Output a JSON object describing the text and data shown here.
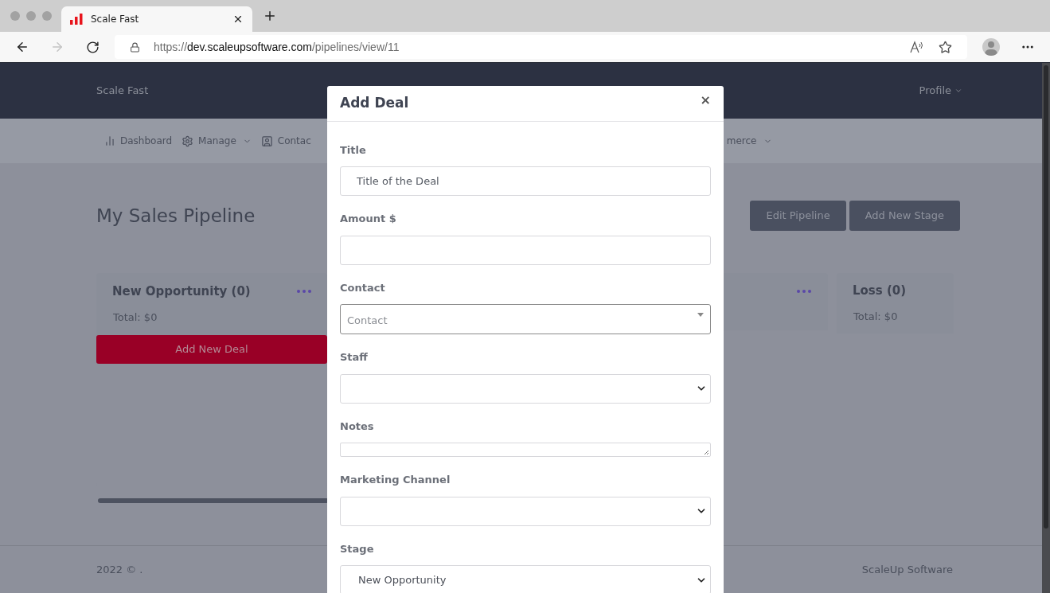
{
  "browser": {
    "tab_title": "Scale Fast",
    "url_scheme": "https://",
    "url_host": "dev.scaleupsoftware.com",
    "url_path": "/pipelines/view/11"
  },
  "navbar": {
    "brand": "Scale Fast",
    "profile": "Profile"
  },
  "nav_items": [
    {
      "label": "Dashboard",
      "caret": false
    },
    {
      "label": "Manage",
      "caret": true
    },
    {
      "label": "Contac",
      "caret": false
    },
    {
      "label": "merce",
      "caret": true
    }
  ],
  "page": {
    "title": "My Sales Pipeline",
    "buttons": [
      "Edit Pipeline",
      "Add New Stage"
    ]
  },
  "stages": [
    {
      "kind": "full",
      "title": "New Opportunity (0)",
      "total": "Total: $0",
      "add_button": "Add New Deal"
    },
    {
      "kind": "hidden"
    },
    {
      "kind": "plain",
      "title": "Loss (0)",
      "total": "Total: $0"
    }
  ],
  "footer": {
    "left": "2022 © .",
    "right": "ScaleUp Software"
  },
  "modal": {
    "title": "Add Deal",
    "close": "×",
    "fields": [
      {
        "label": "Title",
        "kind": "text",
        "placeholder": "Title of the Deal"
      },
      {
        "label": "Amount $",
        "kind": "text"
      },
      {
        "label": "Contact",
        "kind": "search-select",
        "placeholder": "Contact"
      },
      {
        "label": "Staff",
        "kind": "select"
      },
      {
        "label": "Notes",
        "kind": "textarea"
      },
      {
        "label": "Marketing Channel",
        "kind": "select"
      },
      {
        "label": "Stage",
        "kind": "select",
        "value": "New Opportunity"
      }
    ]
  }
}
